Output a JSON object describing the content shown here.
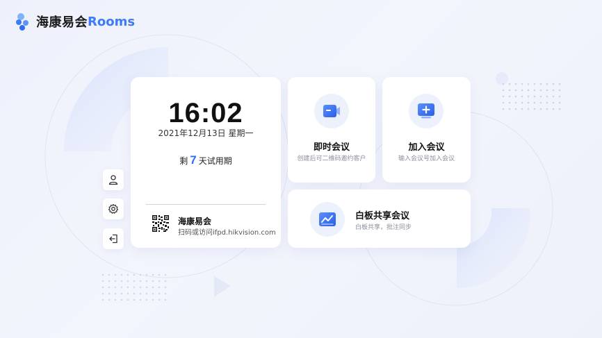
{
  "app": {
    "title": "海康易会",
    "title_accent": "Rooms"
  },
  "clock": {
    "time": "16:02",
    "date": "2021年12月13日 星期一",
    "trial_prefix": "剩",
    "trial_days": "7",
    "trial_suffix": "天试用期",
    "brand_name": "海康易会",
    "brand_url": "扫码或访问ifpd.hikvision.com"
  },
  "features": {
    "instant": {
      "title": "即时会议",
      "subtitle": "创建后可二维码邀约客户"
    },
    "join": {
      "title": "加入会议",
      "subtitle": "输入会议号加入会议"
    },
    "whiteboard": {
      "title": "白板共享会议",
      "subtitle": "白板共享，批注同步"
    }
  },
  "side_buttons": [
    "user-icon",
    "gear-icon",
    "logout-icon"
  ],
  "colors": {
    "accent": "#3d7bf7",
    "icon_blue": "#2f6df5",
    "background": "#eef1fb"
  }
}
